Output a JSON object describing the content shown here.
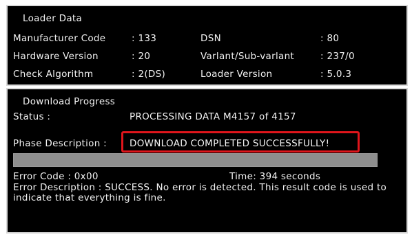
{
  "loader": {
    "title": "Loader Data",
    "rows": [
      {
        "label": "Manufacturer Code",
        "value": ": 133",
        "label2": "DSN",
        "value2": ": 80"
      },
      {
        "label": "Hardware Version",
        "value": ": 20",
        "label2": "Varlant/Sub-varlant",
        "value2": ": 237/0"
      },
      {
        "label": "Check Algorithm",
        "value": ": 2(DS)",
        "label2": "Loader Version",
        "value2": ": 5.0.3"
      }
    ]
  },
  "progress": {
    "title": "Download Progress",
    "status_label": "Status :",
    "status_value": "PROCESSING DATA M4157 of 4157",
    "phase_label": "Phase Description :",
    "phase_value": "DOWNLOAD COMPLETED SUCCESSFULLY!",
    "progress_fraction": 1.0,
    "error_code": "Error Code : 0x00",
    "time": "Time: 394 seconds",
    "error_description": "Error Description : SUCCESS. No error is detected. This result code is used to indicate that everything is fine."
  },
  "colors": {
    "background": "#000000",
    "text": "#f2f2f2",
    "highlight": "#e0151b",
    "progress_bar": "#8e8e8e"
  }
}
